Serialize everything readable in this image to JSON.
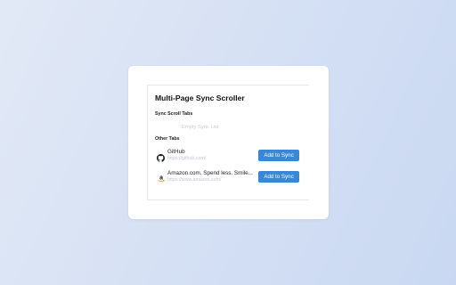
{
  "popup": {
    "title": "Multi-Page Sync Scroller",
    "sync_section_label": "Sync Scroll Tabs",
    "sync_empty_text": "Empty Sync List",
    "other_section_label": "Other Tabs",
    "other_tabs": [
      {
        "title": "GitHub",
        "url": "https://github.com/",
        "icon": "github-icon",
        "button_label": "Add to Sync"
      },
      {
        "title": "Amazon.com. Spend less. Smile...",
        "url": "https://www.amazon.com/",
        "icon": "amazon-icon",
        "button_label": "Add to Sync"
      }
    ]
  },
  "colors": {
    "accent": "#3a87d6",
    "background_start": "#e2e9f6",
    "background_end": "#c9d8f2"
  }
}
